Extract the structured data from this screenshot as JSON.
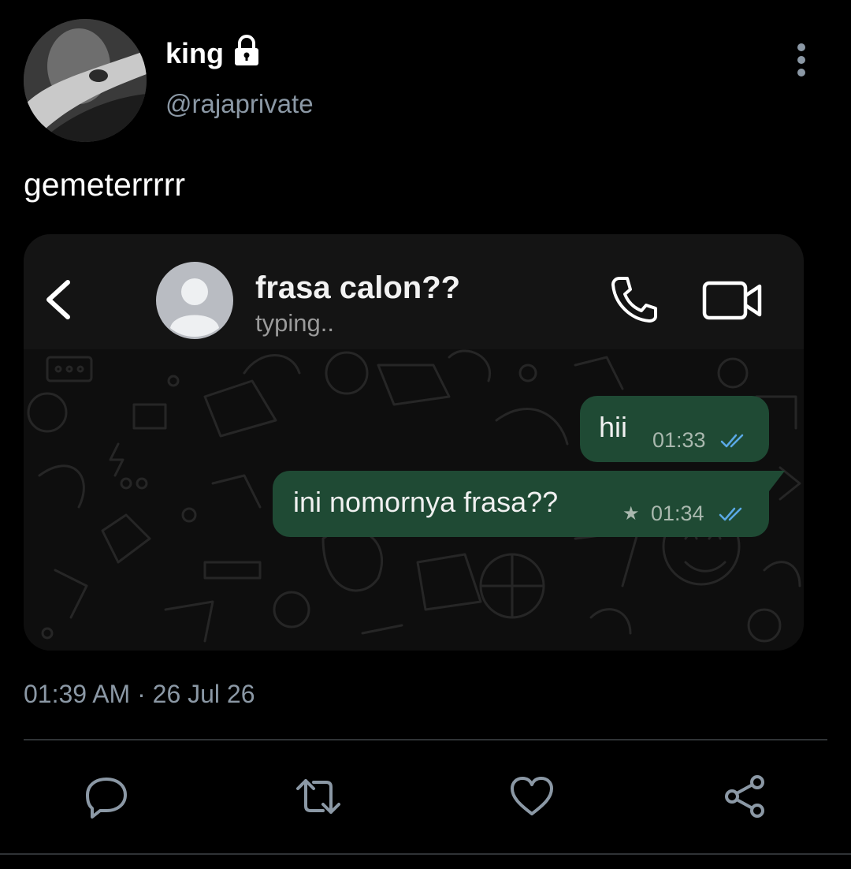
{
  "tweet": {
    "author_name": "king",
    "author_handle": "@rajaprivate",
    "text": "gemeterrrrr",
    "timestamp": "01:39 AM · 26 Jul 26",
    "protected_icon": "lock-icon",
    "menu_icon": "more-vertical-icon"
  },
  "embedded_chat": {
    "contact_name": "frasa calon??",
    "status": "typing..",
    "header_icons": [
      "back-arrow-icon",
      "contact-avatar-icon",
      "phone-call-icon",
      "video-call-icon"
    ],
    "messages": [
      {
        "text": "hii",
        "time": "01:33",
        "starred": false,
        "ticks": "double-check-icon"
      },
      {
        "text": "ini nomornya frasa??",
        "time": "01:34",
        "starred": true,
        "star": "★",
        "ticks": "double-check-icon"
      }
    ]
  },
  "actions": [
    {
      "name": "reply",
      "icon": "reply-icon"
    },
    {
      "name": "retweet",
      "icon": "retweet-icon"
    },
    {
      "name": "like",
      "icon": "heart-icon"
    },
    {
      "name": "share",
      "icon": "share-icon"
    }
  ],
  "colors": {
    "background": "#000000",
    "secondary_text": "#8b98a5",
    "bubble": "#1f4a34",
    "read_ticks": "#5aa9e6"
  }
}
